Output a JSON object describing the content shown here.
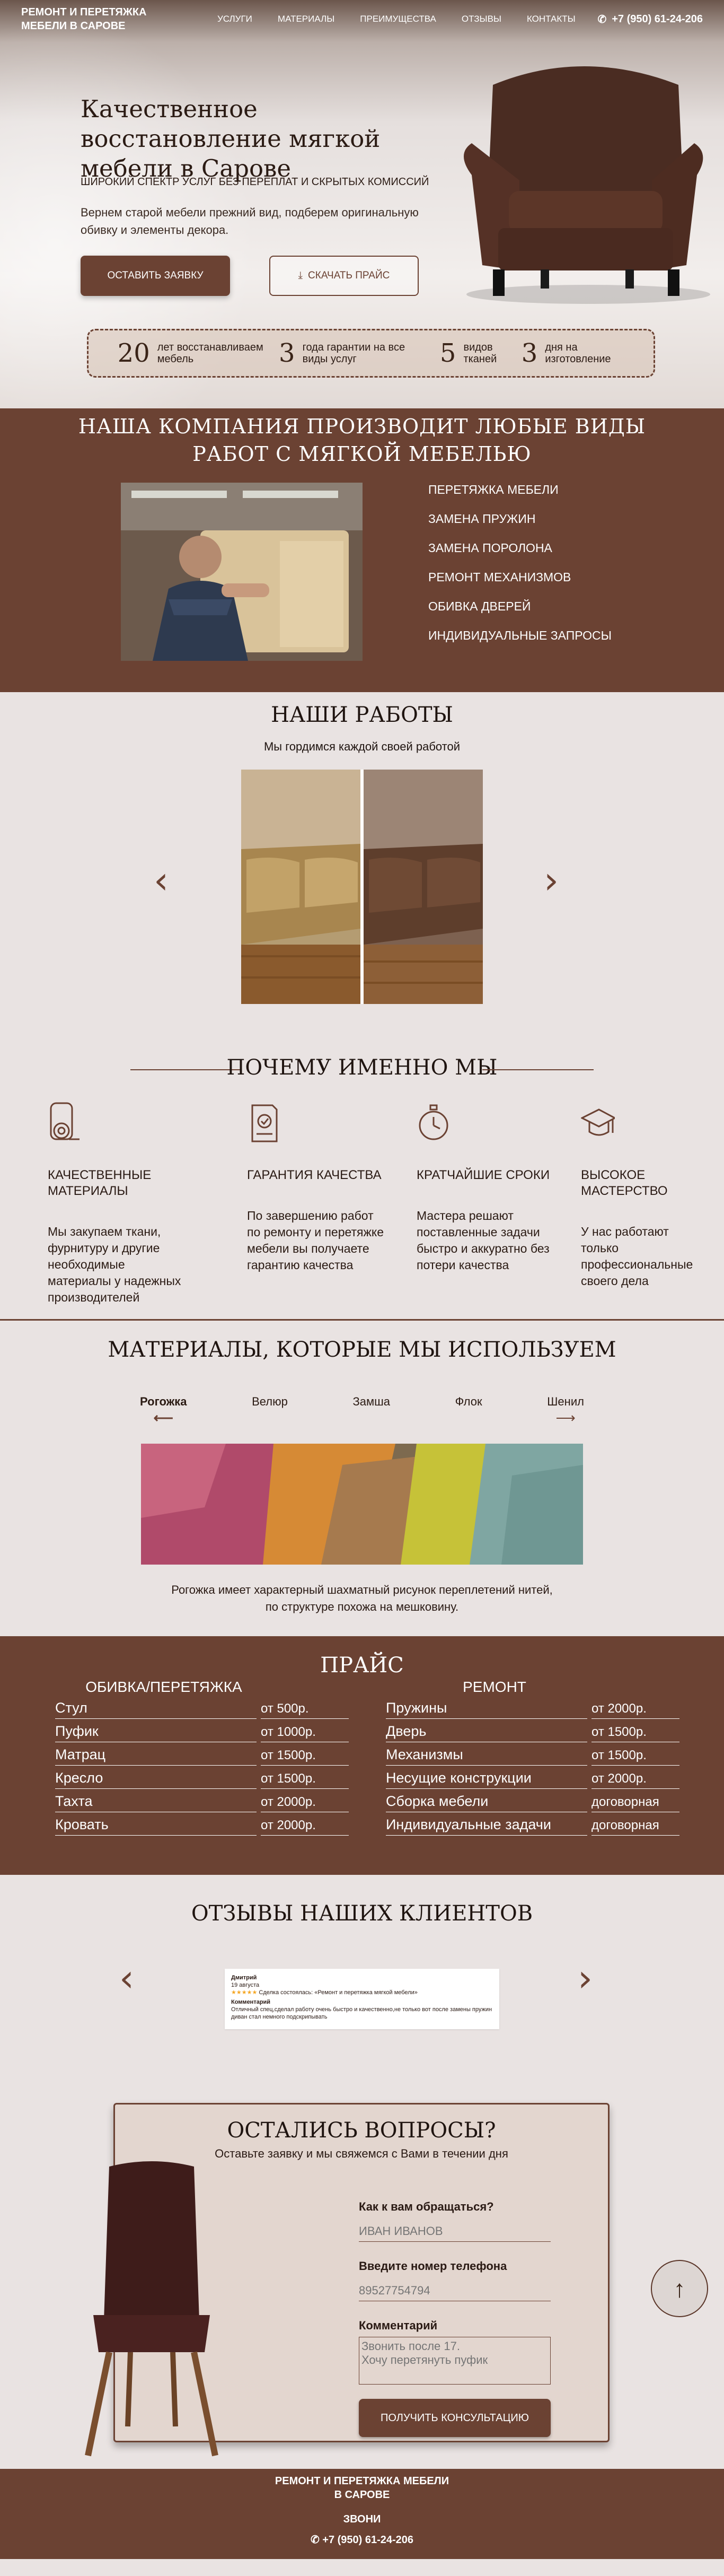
{
  "header": {
    "logo": "Ремонт и перетяжка мебели в Сарове",
    "nav": [
      "Услуги",
      "Материалы",
      "Преимущества",
      "Отзывы",
      "Контакты"
    ],
    "phone": "+7 (950) 61-24-206"
  },
  "hero": {
    "title": "Качественное восстановление мягкой мебели в Сарове",
    "subtitle": "Широкий спектр услуг без переплат и скрытых комиссий",
    "description": "Вернем старой мебели прежний вид, подберем оригинальную обивку и элементы декора.",
    "cta_primary": "Оставить заявку",
    "cta_secondary": "Скачать прайс",
    "stats": [
      {
        "num": "20",
        "label": "лет восстанавливаем мебель"
      },
      {
        "num": "3",
        "label": "года гарантии на все виды услуг"
      },
      {
        "num": "5",
        "label": "видов тканей"
      },
      {
        "num": "3",
        "label": "дня на изготовление"
      }
    ]
  },
  "services": {
    "title": "Наша компания производит любые виды работ с мягкой мебелью",
    "items": [
      "Перетяжка мебели",
      "Замена пружин",
      "Замена поролона",
      "Ремонт механизмов",
      "Обивка дверей",
      "Индивидуальные запросы"
    ]
  },
  "works": {
    "title": "Наши работы",
    "tagline": "Мы гордимся каждой своей работой"
  },
  "why": {
    "title": "Почему именно мы",
    "items": [
      {
        "icon": "fabric-roll-icon",
        "title": "Качественные материалы",
        "text": "Мы закупаем ткани, фурнитуру и другие необходимые материалы у надежных производителей"
      },
      {
        "icon": "certificate-icon",
        "title": "Гарантия качества",
        "text": "По завершению работ по ремонту и перетяжке мебели вы получаете гарантию качества"
      },
      {
        "icon": "stopwatch-icon",
        "title": "Кратчайшие сроки",
        "text": "Мастера решают поставленные задачи быстро и аккуратно без потери качества"
      },
      {
        "icon": "graduation-cap-icon",
        "title": "Высокое мастерство",
        "text": "У нас работают только профессиональные своего дела"
      }
    ]
  },
  "materials": {
    "title": "Материалы, которые мы используем",
    "tabs": [
      "Рогожка",
      "Велюр",
      "Замша",
      "Флок",
      "Шенил"
    ],
    "active": "Рогожка",
    "description_line1": "Рогожка имеет характерный шахматный рисунок переплетений нитей,",
    "description_line2": "по структуре похожа на мешковину."
  },
  "price": {
    "title": "Прайс",
    "left": {
      "heading": "Обивка/перетяжка",
      "rows": [
        {
          "name": "Стул",
          "value": "от 500р."
        },
        {
          "name": "Пуфик",
          "value": "от 1000р."
        },
        {
          "name": "Матрац",
          "value": "от 1500р."
        },
        {
          "name": "Кресло",
          "value": "от 1500р."
        },
        {
          "name": "Тахта",
          "value": "от 2000р."
        },
        {
          "name": "Кровать",
          "value": "от 2000р."
        }
      ]
    },
    "right": {
      "heading": "Ремонт",
      "rows": [
        {
          "name": "Пружины",
          "value": "от 2000р."
        },
        {
          "name": "Дверь",
          "value": "от 1500р."
        },
        {
          "name": "Механизмы",
          "value": "от 1500р."
        },
        {
          "name": "Несущие конструкции",
          "value": "от 2000р."
        },
        {
          "name": "Сборка мебели",
          "value": "договорная"
        },
        {
          "name": "Индивидуальные задачи",
          "value": "договорная"
        }
      ]
    }
  },
  "reviews": {
    "title": "Отзывы наших клиентов",
    "card": {
      "name": "Дмитрий",
      "date": "19 августа",
      "stars": "★★★★★",
      "summary": "Сделка состоялась: «Ремонт и перетяжка мягкой мебели»",
      "comment_label": "Комментарий",
      "comment": "Отличный спец,сделал работу очень быстро и качественно,не только вот после замены пружин диван стал немного подскрипывать"
    }
  },
  "form": {
    "title": "Остались вопросы?",
    "subtitle": "Оставьте заявку и мы свяжемся с Вами в течении дня",
    "name_label": "Как к вам обращаться?",
    "name_placeholder": "ИВАН ИВАНОВ",
    "phone_label": "Введите номер телефона",
    "phone_placeholder": "89527754794",
    "comment_label": "Комментарий",
    "comment_placeholder": "Звонить после 17.\nХочу перетянуть пуфик",
    "submit": "Получить консультацию"
  },
  "footer": {
    "logo": "Ремонт и перетяжка мебели в Сарове",
    "call": "Звони",
    "phone": "+7 (950) 61-24-206"
  },
  "colors": {
    "brand": "#6b4233",
    "background": "#e9e3e2"
  }
}
